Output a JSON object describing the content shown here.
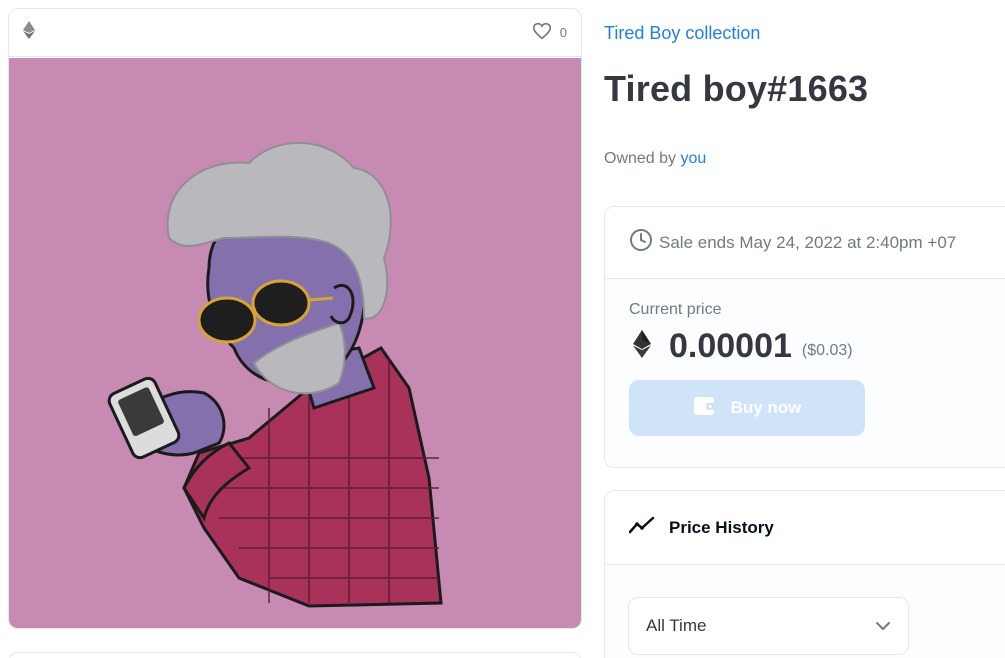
{
  "card": {
    "chain_icon": "ethereum-icon",
    "favorite_icon": "heart-icon",
    "favorite_count": "0",
    "image_background": "#c68ab3"
  },
  "collection": {
    "name": "Tired Boy collection"
  },
  "item": {
    "title": "Tired boy#1663"
  },
  "owner": {
    "prefix": "Owned by",
    "name": "you"
  },
  "sale": {
    "clock_icon": "clock-icon",
    "ends_text": "Sale ends May 24, 2022 at 2:40pm +07",
    "price_label": "Current price",
    "price_value": "0.00001",
    "price_usd": "($0.03)",
    "buy_label": "Buy now",
    "buy_icon": "wallet-icon"
  },
  "history": {
    "title": "Price History",
    "icon": "trend-line-icon",
    "range_selected": "All Time",
    "dropdown_icon": "chevron-down-icon"
  },
  "colors": {
    "accent": "#2081e2",
    "buy_button": "#cfe3f9",
    "text_primary": "#353840",
    "text_secondary": "#707a83"
  }
}
